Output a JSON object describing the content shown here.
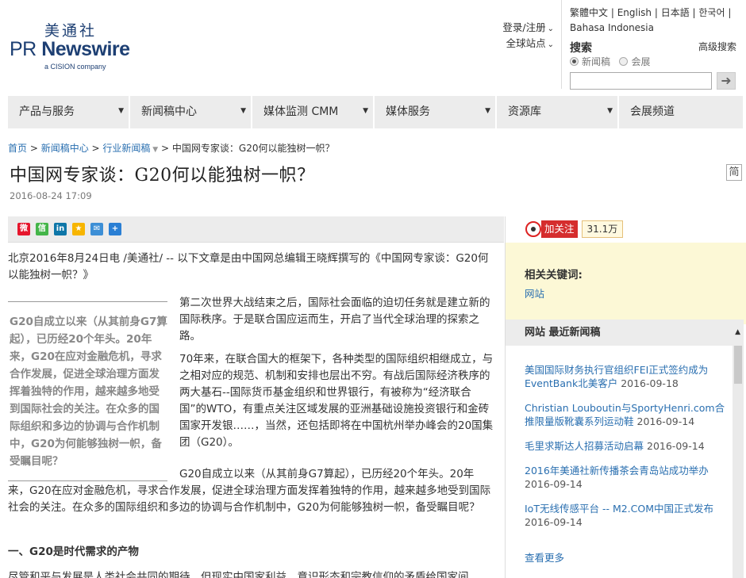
{
  "logo": {
    "cn": "美通社",
    "en_a": "PR ",
    "en_b": "Newswire",
    "sub": "a CISION company"
  },
  "header": {
    "login": "登录/注册",
    "global_sites": "全球站点",
    "languages": [
      "繁體中文",
      "English",
      "日本語",
      "한국어",
      "Bahasa Indonesia"
    ],
    "search_title": "搜索",
    "advanced_search": "高级搜索",
    "radio_news": "新闻稿",
    "radio_member": "会展",
    "search_placeholder": ""
  },
  "nav": [
    "产品与服务",
    "新闻稿中心",
    "媒体监测 CMM",
    "媒体服务",
    "资源库",
    "会展频道"
  ],
  "breadcrumb": {
    "home": "首页",
    "newsroom": "新闻稿中心",
    "industry": "行业新闻稿",
    "current": "> 中国网专家谈：G20何以能独树一帜？"
  },
  "article": {
    "title": "中国网专家谈：G20何以能独树一帜？",
    "simp_label": "简",
    "date": "2016-08-24 17:09",
    "lead": "北京2016年8月24日电 /美通社/ -- 以下文章是由中国网总编辑王晓辉撰写的《中国网专家谈：G20何以能独树一帜？》",
    "pullquote": "G20自成立以来（从其前身G7算起），已历经20个年头。20年来，G20在应对金融危机，寻求合作发展，促进全球治理方面发挥着独特的作用，越来越多地受到国际社会的关注。在众多的国际组织和多边的协调与合作机制中，G20为何能够独树一帜，备受瞩目呢？",
    "p1": "第二次世界大战结束之后，国际社会面临的迫切任务就是建立新的国际秩序。于是联合国应运而生，开启了当代全球治理的探索之路。",
    "p2": "70年来，在联合国大的框架下，各种类型的国际组织相继成立，与之相对应的规范、机制和安排也层出不穷。有战后国际经济秩序的两大基石--国际货币基金组织和世界银行，有被称为“经济联合国”的WTO，有重点关注区域发展的亚洲基础设施投资银行和金砖国家开发银……，当然，还包括即将在中国杭州举办峰会的20国集团（G20）。",
    "p3": "G20自成立以来（从其前身G7算起），已历经20个年头。20年来，G20在应对金融危机，寻求合作发展，促进全球治理方面发挥着独特的作用，越来越多地受到国际社会的关注。在众多的国际组织和多边的协调与合作机制中，G20为何能够独树一帜，备受瞩目呢？",
    "section1": "一、G20是时代需求的产物",
    "p4": "尽管和平与发展是人类社会共同的期待，但现实中国家利益、意识形态和宗教信仰的矛盾给国家间"
  },
  "sidebar": {
    "follow": "加关注",
    "fans": "31.1万",
    "keywords_title": "相关关键词:",
    "keyword": "网站",
    "news_title": "网站 最近新闻稿",
    "news": [
      {
        "title": "美国国际财务执行官组织FEI正式签约成为EventBank北美客户",
        "date": "2016-09-18"
      },
      {
        "title": "Christian Louboutin与SportyHenri.com合推限量版靴囊系列运动鞋",
        "date": "2016-09-14"
      },
      {
        "title": "毛里求斯达人招募活动启幕",
        "date": "2016-09-14"
      },
      {
        "title": "2016年美通社新传播茶会青岛站成功举办",
        "date": "2016-09-14"
      },
      {
        "title": "IoT无线传感平台 -- M2.COM中国正式发布",
        "date": "2016-09-14"
      }
    ],
    "more": "查看更多"
  }
}
